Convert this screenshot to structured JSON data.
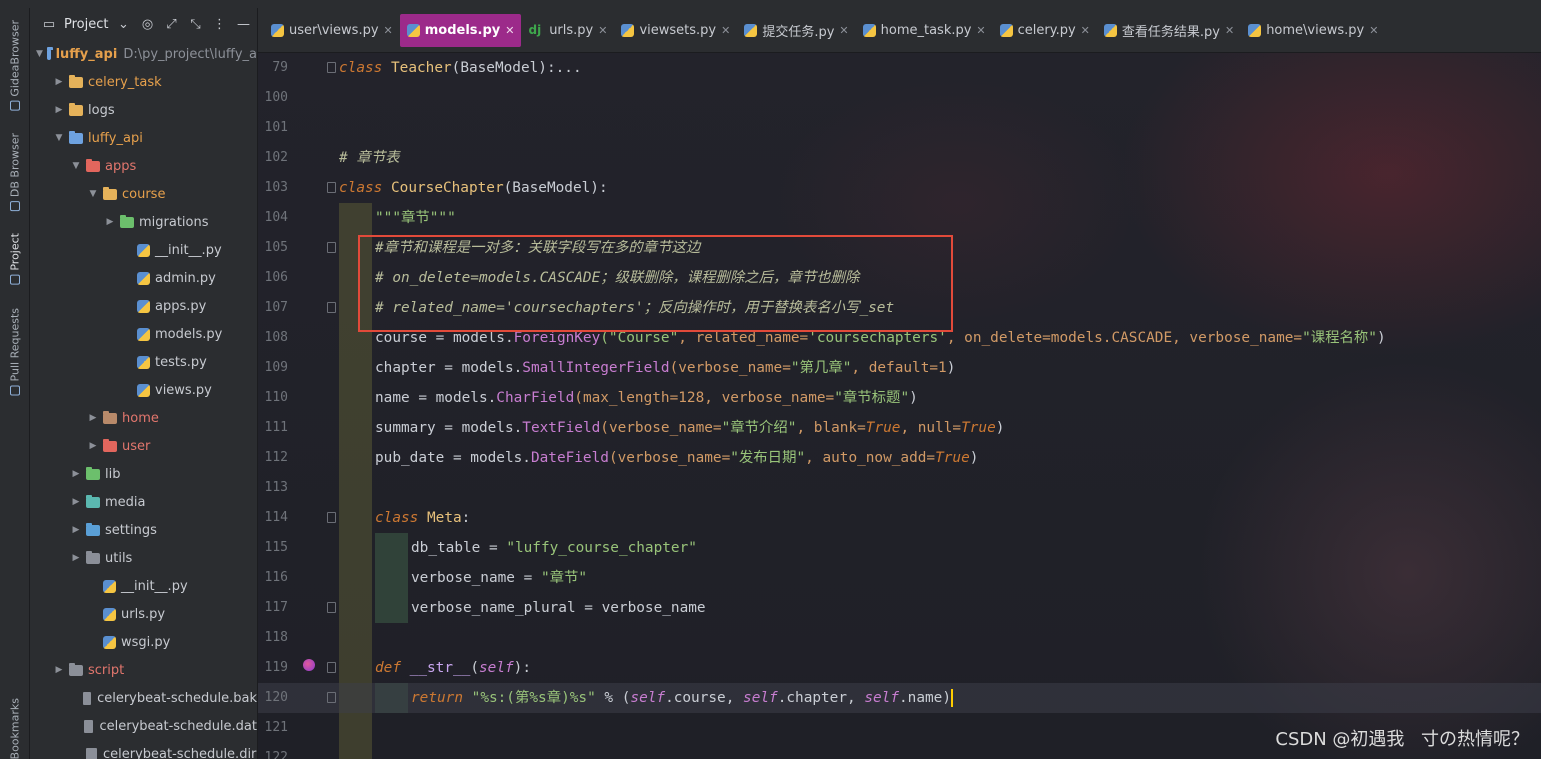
{
  "toolstrip": {
    "tabs": [
      {
        "label": "GideaBrowser"
      },
      {
        "label": "DB Browser"
      },
      {
        "label": "Project"
      },
      {
        "label": "Pull Requests"
      },
      {
        "label": "Bookmarks"
      }
    ]
  },
  "project": {
    "header_label": "Project",
    "tree": [
      {
        "label": "luffy_api",
        "extra": "D:\\py_project\\luffy_a",
        "depth": 0,
        "kind": "folder",
        "open": true,
        "color": "#6ea2e0",
        "text": "orange"
      },
      {
        "label": "celery_task",
        "depth": 1,
        "kind": "folder",
        "open": false,
        "color": "#e5b25a",
        "text": "orange"
      },
      {
        "label": "logs",
        "depth": 1,
        "kind": "folder",
        "open": false,
        "color": "#e5b25a",
        "text": ""
      },
      {
        "label": "luffy_api",
        "depth": 1,
        "kind": "folder",
        "open": true,
        "color": "#6ea2e0",
        "text": "orange"
      },
      {
        "label": "apps",
        "depth": 2,
        "kind": "folder",
        "open": true,
        "color": "#e2665d",
        "text": "red"
      },
      {
        "label": "course",
        "depth": 3,
        "kind": "folder",
        "open": true,
        "color": "#e5b25a",
        "text": "orange"
      },
      {
        "label": "migrations",
        "depth": 4,
        "kind": "folder",
        "open": false,
        "color": "#6cbf6c",
        "text": ""
      },
      {
        "label": "__init__.py",
        "depth": 5,
        "kind": "py",
        "text": ""
      },
      {
        "label": "admin.py",
        "depth": 5,
        "kind": "py",
        "text": ""
      },
      {
        "label": "apps.py",
        "depth": 5,
        "kind": "py",
        "text": ""
      },
      {
        "label": "models.py",
        "depth": 5,
        "kind": "py",
        "text": ""
      },
      {
        "label": "tests.py",
        "depth": 5,
        "kind": "py",
        "text": ""
      },
      {
        "label": "views.py",
        "depth": 5,
        "kind": "py",
        "text": ""
      },
      {
        "label": "home",
        "depth": 3,
        "kind": "folder",
        "open": false,
        "color": "#b88a6a",
        "text": "red"
      },
      {
        "label": "user",
        "depth": 3,
        "kind": "folder",
        "open": false,
        "color": "#e2665d",
        "text": "red"
      },
      {
        "label": "lib",
        "depth": 2,
        "kind": "folder",
        "open": false,
        "color": "#6cbf6c",
        "text": ""
      },
      {
        "label": "media",
        "depth": 2,
        "kind": "folder",
        "open": false,
        "color": "#5bb8b0",
        "text": ""
      },
      {
        "label": "settings",
        "depth": 2,
        "kind": "folder",
        "open": false,
        "color": "#5a9fd6",
        "text": ""
      },
      {
        "label": "utils",
        "depth": 2,
        "kind": "folder",
        "open": false,
        "color": "#8b8f98",
        "text": ""
      },
      {
        "label": "__init__.py",
        "depth": 3,
        "kind": "py",
        "text": ""
      },
      {
        "label": "urls.py",
        "depth": 3,
        "kind": "py",
        "text": ""
      },
      {
        "label": "wsgi.py",
        "depth": 3,
        "kind": "py",
        "text": ""
      },
      {
        "label": "script",
        "depth": 1,
        "kind": "folder",
        "open": false,
        "color": "#8b8f98",
        "text": "red"
      },
      {
        "label": "celerybeat-schedule.bak",
        "depth": 2,
        "kind": "file",
        "text": ""
      },
      {
        "label": "celerybeat-schedule.dat",
        "depth": 2,
        "kind": "file",
        "text": ""
      },
      {
        "label": "celerybeat-schedule.dir",
        "depth": 2,
        "kind": "file",
        "text": ""
      }
    ]
  },
  "tabs": [
    {
      "label": "user\\views.py",
      "icon": "py",
      "active": false
    },
    {
      "label": "models.py",
      "icon": "py",
      "active": true
    },
    {
      "label": "urls.py",
      "icon": "dj",
      "active": false
    },
    {
      "label": "viewsets.py",
      "icon": "py",
      "active": false
    },
    {
      "label": "提交任务.py",
      "icon": "py",
      "active": false
    },
    {
      "label": "home_task.py",
      "icon": "py",
      "active": false
    },
    {
      "label": "celery.py",
      "icon": "py",
      "active": false
    },
    {
      "label": "查看任务结果.py",
      "icon": "py",
      "active": false
    },
    {
      "label": "home\\views.py",
      "icon": "py",
      "active": false
    }
  ],
  "editor": {
    "line_numbers": [
      "79",
      "100",
      "101",
      "102",
      "103",
      "104",
      "105",
      "106",
      "107",
      "108",
      "109",
      "110",
      "111",
      "112",
      "113",
      "114",
      "115",
      "116",
      "117",
      "118",
      "119",
      "120",
      "121",
      "122"
    ],
    "code": {
      "l79_kw": "class",
      "l79_name": "Teacher",
      "l79_base": "(BaseModel):...",
      "l102": "# 章节表",
      "l103_kw": "class",
      "l103_name": "CourseChapter",
      "l103_base": "(BaseModel):",
      "l104": "\"\"\"章节\"\"\"",
      "l105": "#章节和课程是一对多：关联字段写在多的章节这边",
      "l106_a": "# on_delete=models.CASCADE",
      "l106_b": "；级联删除，课程删除之后，章节也删除",
      "l107_a": "# related_name='coursechapters'",
      "l107_b": "；反向操作时，用于替换表名小写",
      "l107_c": "_set",
      "l108_a": "course = models.",
      "l108_fn": "ForeignKey",
      "l108_s1": "(\"Course\"",
      "l108_p1": ", related_name=",
      "l108_s2": "'coursechapters'",
      "l108_p2": ", on_delete=models.CASCADE, verbose_name=",
      "l108_s3": "\"课程名称\"",
      "l108_end": ")",
      "l109_a": "chapter = models.",
      "l109_fn": "SmallIntegerField",
      "l109_p1": "(verbose_name=",
      "l109_s1": "\"第几章\"",
      "l109_p2": ", default=",
      "l109_n": "1",
      "l109_end": ")",
      "l110_a": "name = models.",
      "l110_fn": "CharField",
      "l110_p1": "(max_length=",
      "l110_n": "128",
      "l110_p2": ", verbose_name=",
      "l110_s1": "\"章节标题\"",
      "l110_end": ")",
      "l111_a": "summary = models.",
      "l111_fn": "TextField",
      "l111_p1": "(verbose_name=",
      "l111_s1": "\"章节介绍\"",
      "l111_p2": ", blank=",
      "l111_k1": "True",
      "l111_p3": ", null=",
      "l111_k2": "True",
      "l111_end": ")",
      "l112_a": "pub_date = models.",
      "l112_fn": "DateField",
      "l112_p1": "(verbose_name=",
      "l112_s1": "\"发布日期\"",
      "l112_p2": ", auto_now_add=",
      "l112_k1": "True",
      "l112_end": ")",
      "l114_kw": "class",
      "l114_name": "Meta",
      "l114_end": ":",
      "l115_a": "db_table = ",
      "l115_s": "\"luffy_course_chapter\"",
      "l116_a": "verbose_name = ",
      "l116_s": "\"章节\"",
      "l117": "verbose_name_plural = verbose_name",
      "l119_kw": "def",
      "l119_fn": "__str__",
      "l119_p": "(",
      "l119_self": "self",
      "l119_end": "):",
      "l120_kw": "return",
      "l120_s": "\"%s:(第%s章)%s\"",
      "l120_op": " % (",
      "l120_self1": "self",
      "l120_a1": ".course, ",
      "l120_self2": "self",
      "l120_a2": ".chapter, ",
      "l120_self3": "self",
      "l120_a3": ".name)"
    }
  },
  "watermark": "CSDN @初遇我ㅤ寸の热情呢？",
  "colors": {
    "active_tab": "#9c2a8a",
    "highlight_box": "#e24a3a",
    "caret": "#ffcc00"
  }
}
